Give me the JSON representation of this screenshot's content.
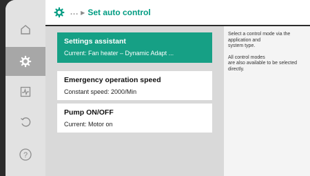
{
  "header": {
    "breadcrumb_dots": "...",
    "breadcrumb_arrow": "▶",
    "title": "Set auto control"
  },
  "sidenav": {
    "items": [
      {
        "icon": "home-icon",
        "active": false
      },
      {
        "icon": "gear-icon",
        "active": true
      },
      {
        "icon": "diagnostics-icon",
        "active": false
      },
      {
        "icon": "undo-icon",
        "active": false
      },
      {
        "icon": "help-icon",
        "active": false
      }
    ]
  },
  "menu": {
    "items": [
      {
        "title": "Settings assistant",
        "subtitle": "Current: Fan heater – Dynamic Adapt ...",
        "selected": true
      },
      {
        "title": "Emergency operation speed",
        "subtitle": "Constant speed: 2000/Min",
        "selected": false
      },
      {
        "title": "Pump ON/OFF",
        "subtitle": "Current: Motor on",
        "selected": false
      }
    ]
  },
  "help": {
    "para1": "Select a control mode via the\napplication and\nsystem type.",
    "para2": "All control modes\nare also available to be selected\ndirectly."
  },
  "colors": {
    "accent": "#009c82",
    "selected_card": "#16a085",
    "bezel": "#2b2b2b"
  }
}
